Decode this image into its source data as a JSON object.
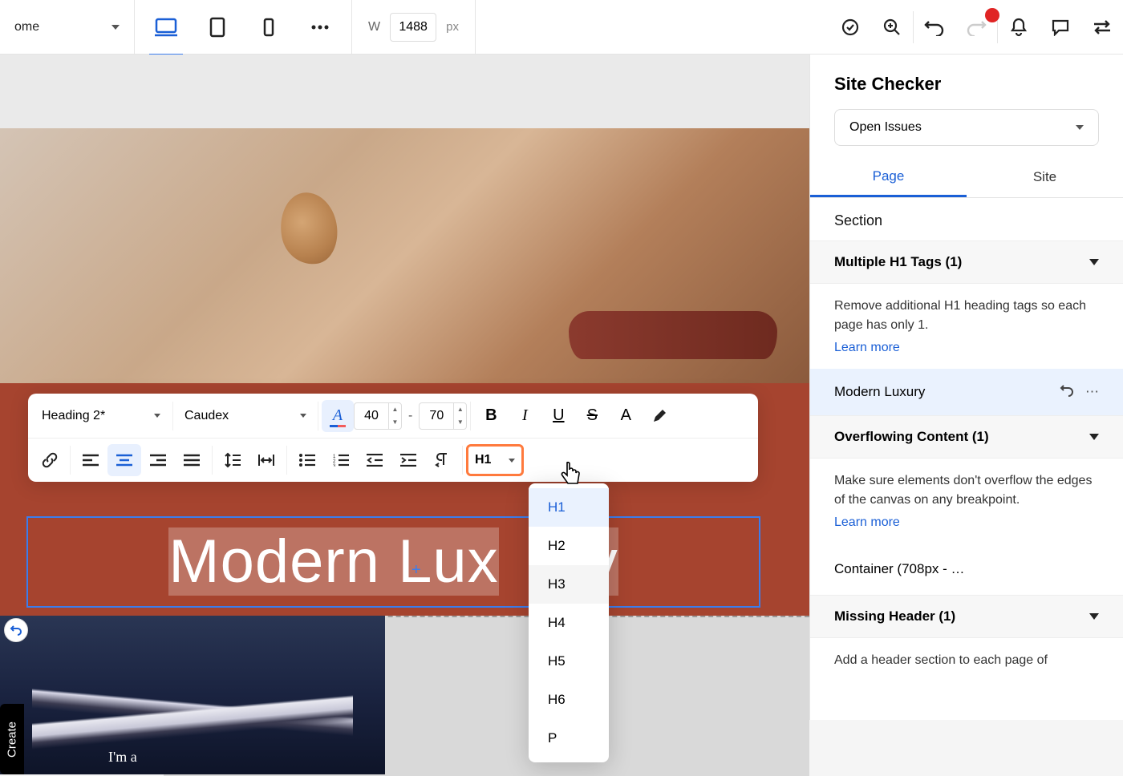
{
  "toolbar": {
    "page_name": "ome",
    "width_label": "W",
    "width_value": "1488",
    "width_unit": "px"
  },
  "text_toolbar": {
    "style_preset": "Heading 2*",
    "font_family": "Caudex",
    "font_size": "40",
    "line_height": "70",
    "tag_current": "H1",
    "tag_options": [
      "H1",
      "H2",
      "H3",
      "H4",
      "H5",
      "H6",
      "P"
    ]
  },
  "canvas": {
    "heading_text": "Modern Lux",
    "heading_suffix": "y",
    "create_label": "Create",
    "im_a": "I'm a"
  },
  "site_checker": {
    "title": "Site Checker",
    "filter": "Open Issues",
    "tabs": {
      "page": "Page",
      "site": "Site"
    },
    "section_label": "Section",
    "issues": [
      {
        "title": "Multiple H1 Tags (1)",
        "body": "Remove additional H1 heading tags so each page has only 1.",
        "learn_more": "Learn more",
        "item": "Modern Luxury"
      },
      {
        "title": "Overflowing Content (1)",
        "body": "Make sure elements don't overflow the edges of the canvas on any breakpoint.",
        "learn_more": "Learn more",
        "item": "Container (708px - …"
      },
      {
        "title": "Missing Header (1)",
        "body": "Add a header section to each page of"
      }
    ]
  }
}
